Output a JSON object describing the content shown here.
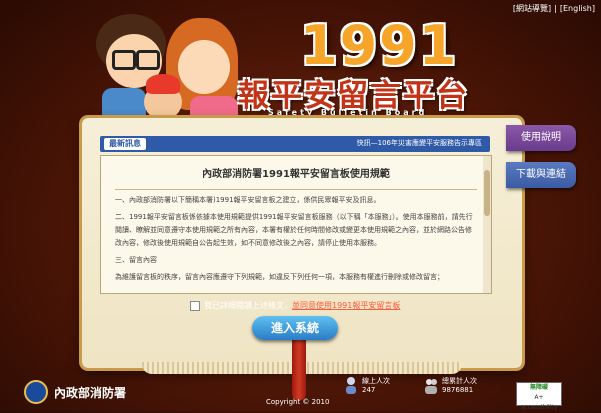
{
  "topnav": {
    "site_nav": "網站導覽",
    "english": "English"
  },
  "logo": {
    "number": "1991",
    "title": "報平安留言平台",
    "subtitle": "Safety Bulletin Board"
  },
  "side_tabs": {
    "usage": "使用說明",
    "download": "下載與連結"
  },
  "latest": {
    "label": "最新訊息",
    "news": "快訊—106年災害應變平安服務告示專區"
  },
  "notice": {
    "title": "內政部消防署1991報平安留言板使用規範",
    "paragraphs": [
      "一、內政部消防署以下簡稱本署)1991報平安留言板之建立，係供民眾報平安及訊息。",
      "二、1991報平安留言板係依據本使用規範提供1991報平安留言板服務（以下稱「本服務」）。使用本服務前，請先行閱讀、瞭解並同意遵守本使用規範之所有內容，本署有權於任何時間修改或變更本使用規範之內容，並於網路公告修改內容，修改後使用規範自公告起生效，如不同意修改後之內容，請停止使用本服務。",
      "三、留言內容",
      "為維護留言板的秩序，留言內容應遵守下列規範，如違反下列任何一項，本服務有權進行刪除或修改留言；"
    ]
  },
  "agree": {
    "text": "我已詳細閱讀上述條文，",
    "link": "並同意使用1991報平安留言板"
  },
  "enter_button": "進入系統",
  "footer": {
    "org_name": "內政部消防署",
    "copyright": "Copyright © 2010",
    "online_label": "線上人次",
    "online_value": "247",
    "total_label": "總累計人次",
    "total_value": "9876881",
    "a11y_top": "無障礙",
    "a11y_bottom": "A+ accessibility"
  },
  "colors": {
    "background": "#4a1506",
    "accent_blue": "#2f5aa8",
    "logo_orange": "#f6a52b",
    "title_red": "#c23418",
    "link_red": "#ff5a3a"
  }
}
